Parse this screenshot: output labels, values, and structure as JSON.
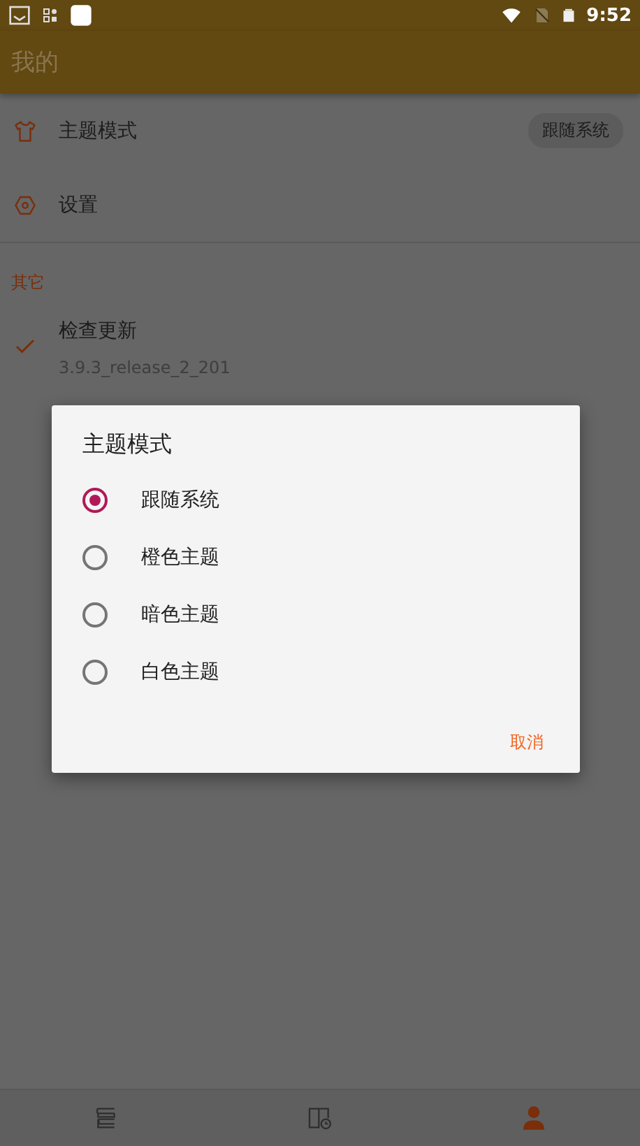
{
  "status_bar": {
    "time": "9:52"
  },
  "app_bar": {
    "title": "我的"
  },
  "settings": [
    {
      "kind": "theme",
      "label": "主题模式",
      "value": "跟随系统"
    },
    {
      "kind": "gear",
      "label": "设置"
    }
  ],
  "section": {
    "title": "其它"
  },
  "update": {
    "label": "检查更新",
    "version": "3.9.3_release_2_201"
  },
  "dialog": {
    "title": "主题模式",
    "options": [
      {
        "label": "跟随系统",
        "selected": true
      },
      {
        "label": "橙色主题",
        "selected": false
      },
      {
        "label": "暗色主题",
        "selected": false
      },
      {
        "label": "白色主题",
        "selected": false
      }
    ],
    "cancel": "取消"
  },
  "bottom_nav": [
    {
      "kind": "books",
      "selected": false
    },
    {
      "kind": "history",
      "selected": false
    },
    {
      "kind": "person",
      "selected": true
    }
  ]
}
